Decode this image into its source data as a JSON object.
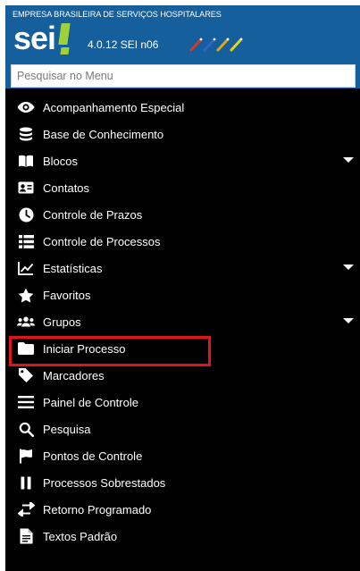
{
  "header": {
    "organization": "EMPRESA BRASILEIRA DE SERVIÇOS HOSPITALARES",
    "logo_text": "sei",
    "version": "4.0.12 SEI n06"
  },
  "search": {
    "placeholder": "Pesquisar no Menu",
    "value": ""
  },
  "menu": {
    "items": [
      {
        "label": "Acompanhamento Especial",
        "icon": "eye-icon"
      },
      {
        "label": "Base de Conhecimento",
        "icon": "database-icon"
      },
      {
        "label": "Blocos",
        "icon": "book-icon",
        "has_submenu": true
      },
      {
        "label": "Contatos",
        "icon": "contact-card-icon"
      },
      {
        "label": "Controle de Prazos",
        "icon": "clock-icon"
      },
      {
        "label": "Controle de Processos",
        "icon": "list-icon"
      },
      {
        "label": "Estatísticas",
        "icon": "line-chart-icon",
        "has_submenu": true
      },
      {
        "label": "Favoritos",
        "icon": "star-icon"
      },
      {
        "label": "Grupos",
        "icon": "users-icon",
        "has_submenu": true
      },
      {
        "label": "Iniciar Processo",
        "icon": "folder-icon",
        "highlighted": true
      },
      {
        "label": "Marcadores",
        "icon": "tag-icon"
      },
      {
        "label": "Painel de Controle",
        "icon": "menu-bars-icon"
      },
      {
        "label": "Pesquisa",
        "icon": "search-icon"
      },
      {
        "label": "Pontos de Controle",
        "icon": "flag-icon"
      },
      {
        "label": "Processos Sobrestados",
        "icon": "pause-icon"
      },
      {
        "label": "Retorno Programado",
        "icon": "exchange-icon"
      },
      {
        "label": "Textos Padrão",
        "icon": "document-icon"
      }
    ]
  },
  "colors": {
    "header_bg": "#155f9c",
    "menu_bg": "#000000",
    "highlight_border": "#e0151c",
    "logo_accent": "#9fd23a"
  }
}
